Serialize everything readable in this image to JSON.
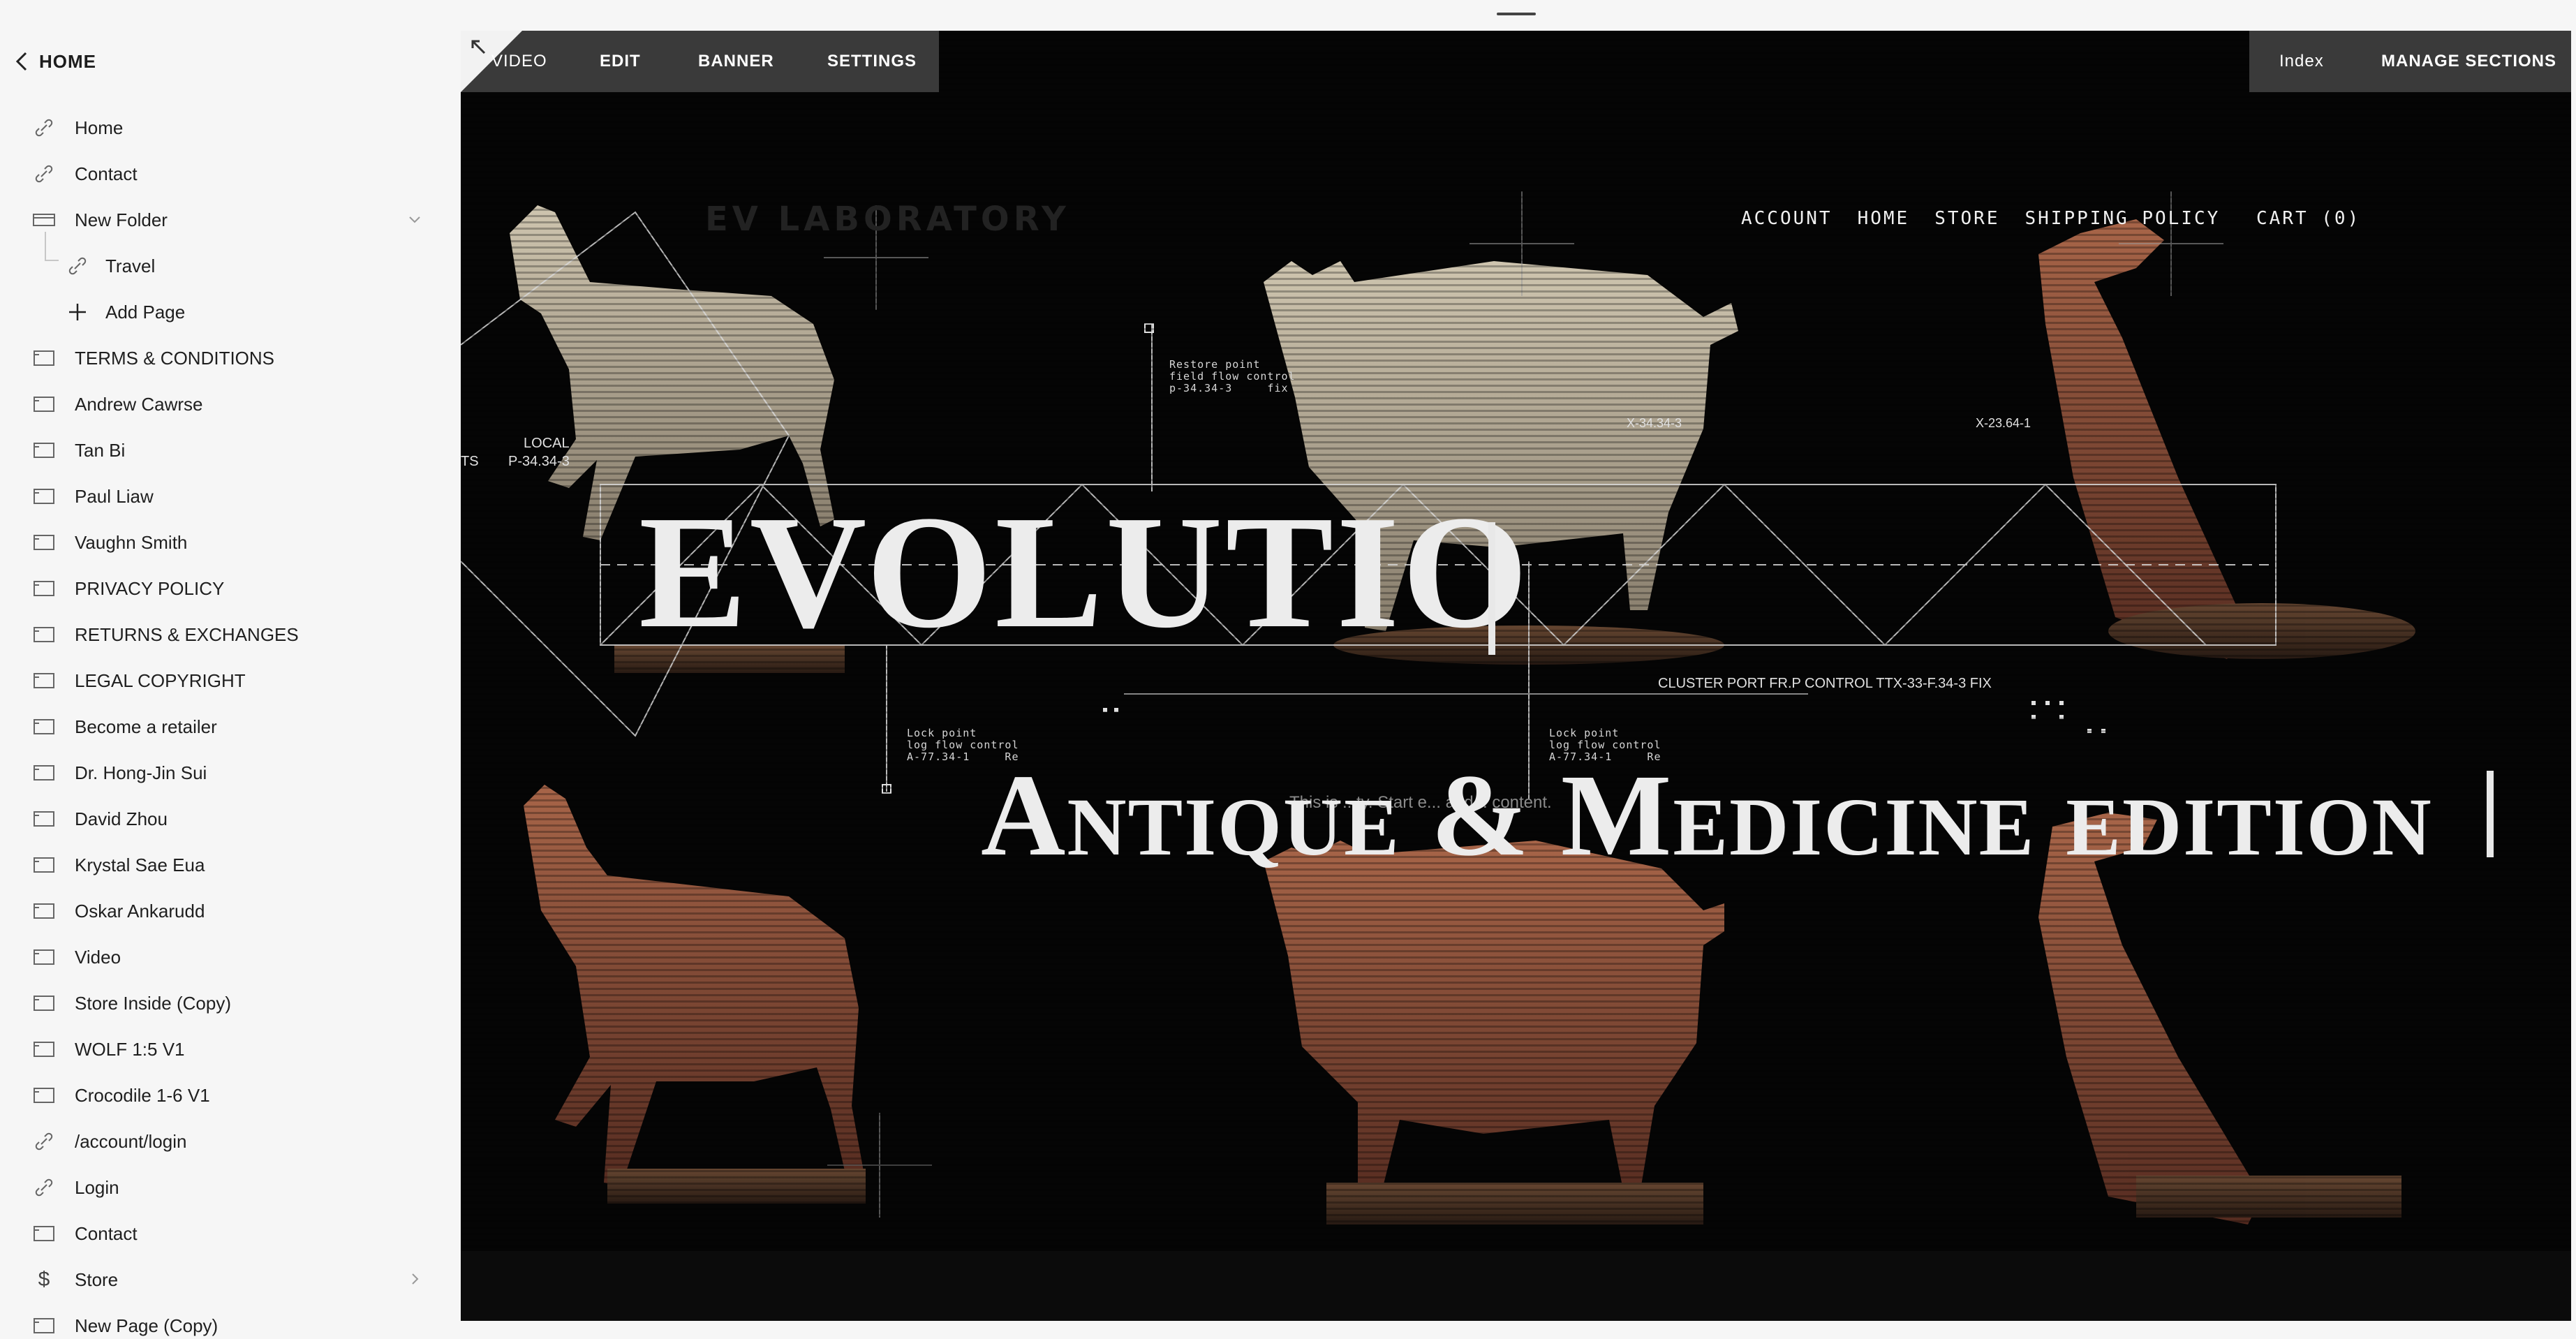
{
  "sidebar": {
    "back_label": "HOME",
    "items": [
      {
        "label": "Home",
        "icon": "link-icon"
      },
      {
        "label": "Contact",
        "icon": "link-icon"
      },
      {
        "label": "New Folder",
        "icon": "folder-icon"
      },
      {
        "label": "Travel",
        "icon": "link-icon"
      },
      {
        "label": "Add Page",
        "icon": "plus-icon"
      },
      {
        "label": "TERMS & CONDITIONS",
        "icon": "page-icon"
      },
      {
        "label": "Andrew Cawrse",
        "icon": "page-icon"
      },
      {
        "label": "Tan Bi",
        "icon": "page-icon"
      },
      {
        "label": "Paul Liaw",
        "icon": "page-icon"
      },
      {
        "label": "Vaughn Smith",
        "icon": "page-icon"
      },
      {
        "label": "PRIVACY POLICY",
        "icon": "page-icon"
      },
      {
        "label": "RETURNS & EXCHANGES",
        "icon": "page-icon"
      },
      {
        "label": "LEGAL COPYRIGHT",
        "icon": "page-icon"
      },
      {
        "label": "Become a retailer",
        "icon": "page-icon"
      },
      {
        "label": "Dr. Hong-Jin Sui",
        "icon": "page-icon"
      },
      {
        "label": "David Zhou",
        "icon": "page-icon"
      },
      {
        "label": "Krystal Sae Eua",
        "icon": "page-icon"
      },
      {
        "label": "Oskar Ankarudd",
        "icon": "page-icon"
      },
      {
        "label": "Video",
        "icon": "page-icon"
      },
      {
        "label": "Store Inside (Copy)",
        "icon": "page-icon"
      },
      {
        "label": "WOLF 1:5 V1",
        "icon": "page-icon"
      },
      {
        "label": "Crocodile 1-6 V1",
        "icon": "page-icon"
      },
      {
        "label": "/account/login",
        "icon": "link-icon"
      },
      {
        "label": "Login",
        "icon": "link-icon"
      },
      {
        "label": "Contact",
        "icon": "page-icon"
      },
      {
        "label": "Store",
        "icon": "dollar-icon"
      },
      {
        "label": "New Page (Copy)",
        "icon": "page-icon"
      }
    ]
  },
  "toolbar": {
    "video": "VIDEO",
    "edit": "EDIT",
    "banner": "BANNER",
    "settings": "SETTINGS",
    "index": "Index",
    "manage_sections": "MANAGE SECTIONS"
  },
  "site": {
    "logo": "EV LABORATORY",
    "nav": [
      "ACCOUNT",
      "HOME",
      "STORE",
      "SHIPPING POLICY"
    ],
    "cart": "CART (0)"
  },
  "hero": {
    "title": "EVOLUTIO",
    "subtitle": "Antique & Medicine edition",
    "faded_text": "This is ...ty. Start e... and... content."
  },
  "hud": {
    "local": "LOCAL",
    "local_code": "P-34.34-3",
    "ts": "TS",
    "restore": "Restore point\nfield flow control\np-34.34-3     fix",
    "x1": "X-34.34-3",
    "x2": "X-23.64-1",
    "cluster": "CLUSTER PORT FR.P CONTROL TTX-33-F.34-3     FIX",
    "lock1": "Lock point\nlog flow control\nA-77.34-1     Re",
    "lock2": "Lock point\nlog flow control\nA-77.34-1     Re"
  },
  "colors": {
    "sidebar_bg": "#f6f6f6",
    "toolbar_bg": "#3a3a3a",
    "canvas_bg": "#050505"
  }
}
